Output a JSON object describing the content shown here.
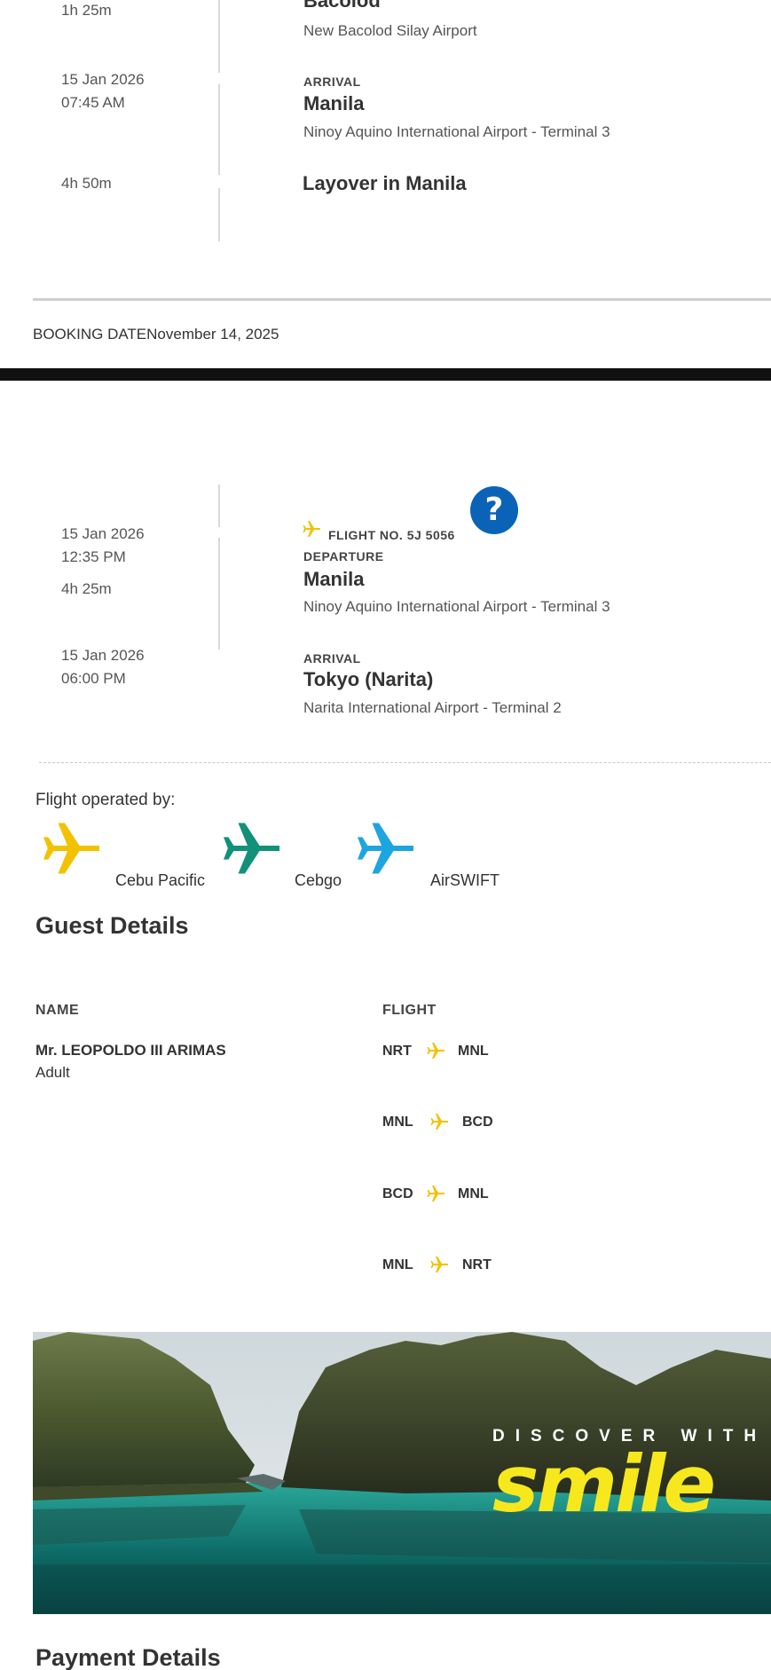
{
  "segment1": {
    "duration": "1h 25m",
    "departure_city": "Bacolod",
    "departure_airport": "New Bacolod Silay Airport",
    "arrival_date": "15 Jan 2026",
    "arrival_time": "07:45 AM",
    "arrival_label": "ARRIVAL",
    "arrival_city": "Manila",
    "arrival_airport": "Ninoy Aquino International Airport - Terminal 3"
  },
  "layover": {
    "duration": "4h 50m",
    "text": "Layover in Manila"
  },
  "booking": {
    "label": "BOOKING DATE",
    "date": "November 14, 2025"
  },
  "segment2": {
    "departure_date": "15 Jan 2026",
    "departure_time": "12:35 PM",
    "duration": "4h 25m",
    "flight_no": "FLIGHT NO. 5J 5056",
    "departure_label": "DEPARTURE",
    "departure_city": "Manila",
    "departure_airport": "Ninoy Aquino International Airport - Terminal 3",
    "arrival_date": "15 Jan 2026",
    "arrival_time": "06:00 PM",
    "arrival_label": "ARRIVAL",
    "arrival_city": "Tokyo (Narita)",
    "arrival_airport": "Narita International Airport - Terminal 2"
  },
  "operated_by": {
    "label": "Flight operated by:",
    "carriers": [
      {
        "name": "Cebu Pacific",
        "icon": "plane-icon",
        "color": "#f2c200"
      },
      {
        "name": "Cebgo",
        "icon": "plane-icon",
        "color": "#12907a"
      },
      {
        "name": "AirSWIFT",
        "icon": "plane-icon",
        "color": "#1ea5e0"
      }
    ]
  },
  "guest_details": {
    "title": "Guest Details",
    "name_header": "NAME",
    "flight_header": "FLIGHT",
    "guest_name": "Mr. LEOPOLDO III ARIMAS",
    "guest_type": "Adult",
    "routes": [
      {
        "from": "NRT",
        "to": "MNL"
      },
      {
        "from": "MNL",
        "to": "BCD"
      },
      {
        "from": "BCD",
        "to": "MNL"
      },
      {
        "from": "MNL",
        "to": "NRT"
      }
    ]
  },
  "banner": {
    "tagline": "DISCOVER WITH",
    "brand": "smile"
  },
  "payment": {
    "title": "Payment Details"
  },
  "colors": {
    "accent_yellow": "#f2c200",
    "help_blue": "#0b63b8"
  }
}
